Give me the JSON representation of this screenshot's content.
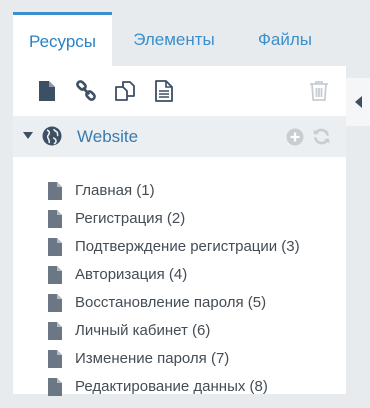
{
  "tabs": [
    {
      "label": "Ресурсы",
      "active": true
    },
    {
      "label": "Элементы",
      "active": false
    },
    {
      "label": "Файлы",
      "active": false
    }
  ],
  "toolbar": {
    "icons": [
      "new-document-icon",
      "link-icon",
      "duplicate-icon",
      "document-text-icon",
      "trash-icon"
    ]
  },
  "tree": {
    "root": {
      "label": "Website",
      "icon": "globe-icon",
      "expanded": true
    },
    "items": [
      {
        "label": "Главная (1)"
      },
      {
        "label": "Регистрация (2)"
      },
      {
        "label": "Подтверждение регистрации (3)"
      },
      {
        "label": "Авторизация (4)"
      },
      {
        "label": "Восстановление пароля (5)"
      },
      {
        "label": "Личный кабинет (6)"
      },
      {
        "label": "Изменение пароля (7)"
      },
      {
        "label": "Редактирование данных (8)"
      }
    ]
  },
  "colors": {
    "accent": "#3a8fcc",
    "icon": "#3d4f63",
    "muted_icon": "#c8cdd2",
    "root_bg": "#eceff1"
  }
}
